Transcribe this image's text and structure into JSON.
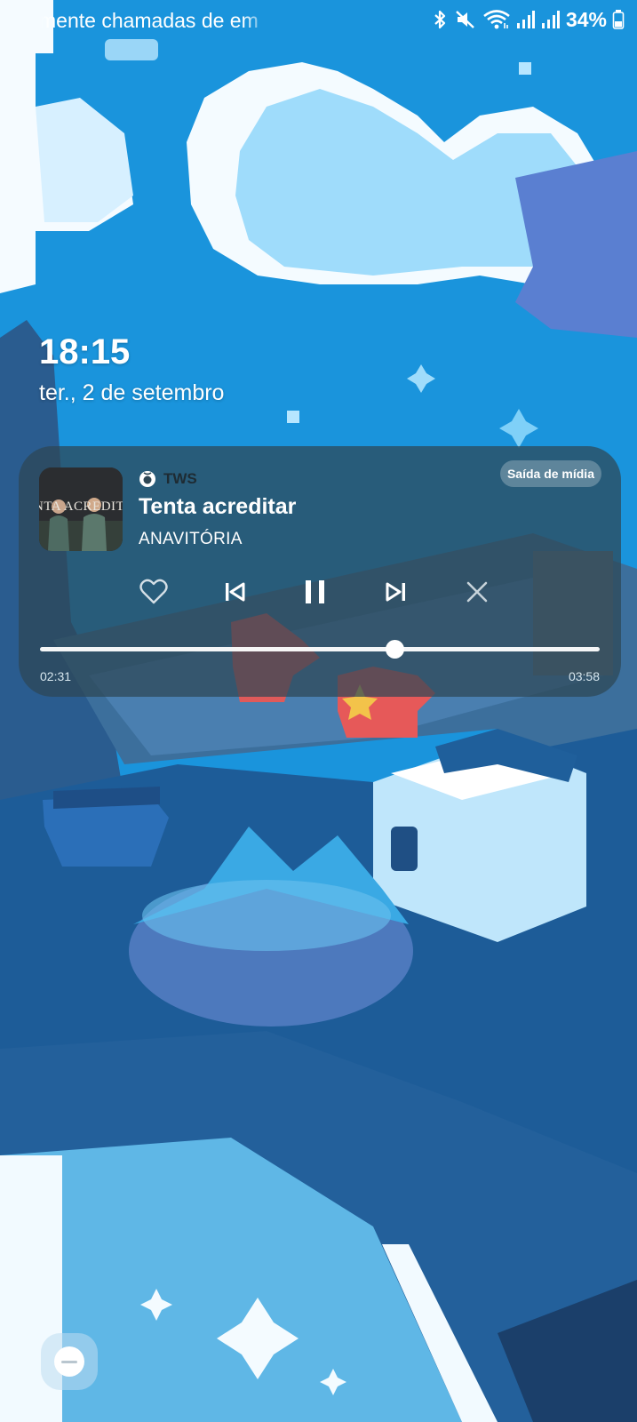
{
  "status_bar": {
    "ticker_text": "mente chamadas de em",
    "battery_percent": "34%",
    "icons": [
      "bluetooth-icon",
      "mute-icon",
      "wifi-icon",
      "signal-icon",
      "signal-icon",
      "battery-icon"
    ]
  },
  "lock_screen": {
    "time": "18:15",
    "date": "ter., 2 de setembro"
  },
  "media_player": {
    "source_app": "TWS",
    "output_button": "Saída de mídia",
    "album_art_text": "NTA ACREDITA",
    "title": "Tenta acreditar",
    "artist": "ANAVITÓRIA",
    "controls": [
      "heart-icon",
      "previous-icon",
      "pause-icon",
      "next-icon",
      "close-icon"
    ],
    "elapsed": "02:31",
    "total": "03:58",
    "progress_fraction": 0.634
  },
  "colors": {
    "card_background": "#2e4654",
    "wallpaper_sky": "#1a8fd6",
    "wallpaper_deep": "#1d4f7a"
  }
}
